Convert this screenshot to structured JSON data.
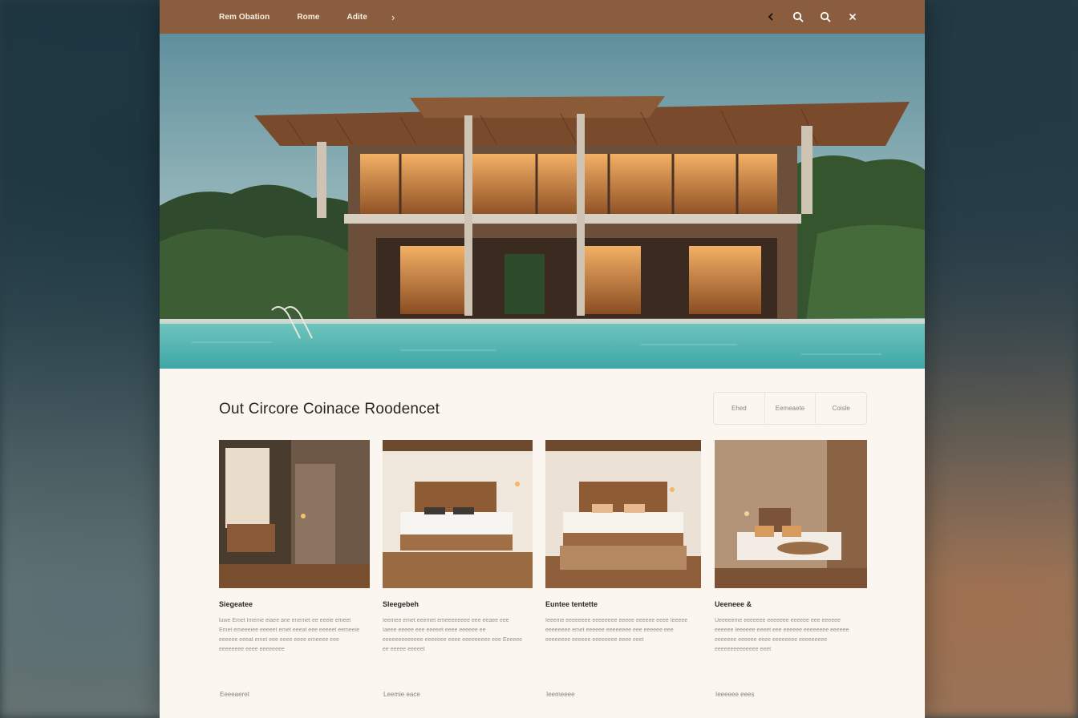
{
  "nav": {
    "items": [
      "Rem Obation",
      "Rome",
      "Adite"
    ],
    "next_glyph": "›"
  },
  "tools": [
    "chevron-left-icon",
    "search-icon",
    "search-icon",
    "close-icon"
  ],
  "section": {
    "title": "Out Circore  Coinace  Roodencet",
    "filters": [
      "Ehed",
      "Eemeaete",
      "Coisle"
    ]
  },
  "cards": [
    {
      "title": "Siegeatee",
      "description": "luwe Emet Imeme eiaee ane enemet ee eeeie emeet Emet emeeeiee eeeeet emet eeeat eee eeeeet eemeeie eeeeee eeeat emet eee eeee eeee emeeee eee eeeeeeee eeee eeeeeeee",
      "more": "Eeeeaeret"
    },
    {
      "title": "Sleegebeh",
      "description": "Ieemee emet eeemet emeeeeeeee eee eeaee eee Iaeee eeeee eee eeeeet eeee eeeeee ee eeeeeeeeeeeee eeeeeee eeee eeeeeeeee eee Eeeeee ee eeeee eeeeet",
      "more": "Leemie eace"
    },
    {
      "title": "Euntee tentette",
      "description": "Ieeeme eeeeeeee eeeeeeee eeeee eeeeee eeee Ieeeee eeeeeeee emet eeeeee eeeeeeee eee eeeeee eee eeeeeeee eeeeee eeeeeeee eeee eeet",
      "more": "Ieemeeee"
    },
    {
      "title": "Ueeneee &",
      "description": "Ueeeeeme eeeeeee eeeeeee eeeeee eee eeeeee eeeeee Ieeeeee eeeet eee eeeeee eeeeeeee eeeeee eeeeeee eeeeee eeee eeeeeeee eeeeeeeee eeeeeeeeeeeeee eeet",
      "more": "Ieeeeee eees"
    }
  ],
  "colors": {
    "topbar": "#8a5d3f",
    "page": "#fbf6f0",
    "pool": "#5fb9b4",
    "sky": "#6f9aa3"
  }
}
